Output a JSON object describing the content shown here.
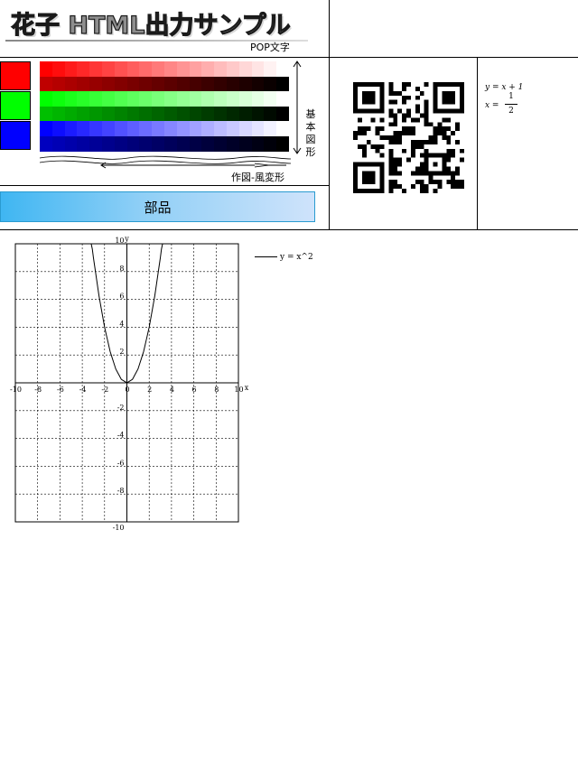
{
  "header": {
    "title": "花子 HTML出力サンプル",
    "pop_label": "POP文字"
  },
  "shapes_panel": {
    "swatch_colors": [
      "#ff0000",
      "#00ff00",
      "#0000ff"
    ],
    "vertical_label": "基本図形",
    "bottom_label": "作図-風変形"
  },
  "parts_button": {
    "label": "部品"
  },
  "qr_code": {
    "icon": "qr-code-icon"
  },
  "formulas": {
    "line1": "y = x + 1",
    "line2_lhs": "x =",
    "frac_num": "1",
    "frac_den": "2"
  },
  "chart_data": {
    "type": "line",
    "x_label": "x",
    "y_label": "y",
    "xlim": [
      -10,
      10
    ],
    "ylim": [
      -10,
      10
    ],
    "grid": true,
    "x_ticks": [
      "-10",
      "-8",
      "-6",
      "-4",
      "-2",
      "0",
      "2",
      "4",
      "6",
      "8",
      "10"
    ],
    "y_ticks": [
      "10",
      "8",
      "6",
      "4",
      "2",
      "-2",
      "-4",
      "-6",
      "-8",
      "-10"
    ],
    "legend_position": "top-right",
    "series": [
      {
        "name": "y = x^2",
        "x": [
          -3.2,
          -3,
          -2.5,
          -2,
          -1.5,
          -1,
          -0.5,
          0,
          0.5,
          1,
          1.5,
          2,
          2.5,
          3,
          3.2
        ],
        "y": [
          10.24,
          9,
          6.25,
          4,
          2.25,
          1,
          0.25,
          0,
          0.25,
          1,
          2.25,
          4,
          6.25,
          9,
          10.24
        ]
      }
    ]
  }
}
